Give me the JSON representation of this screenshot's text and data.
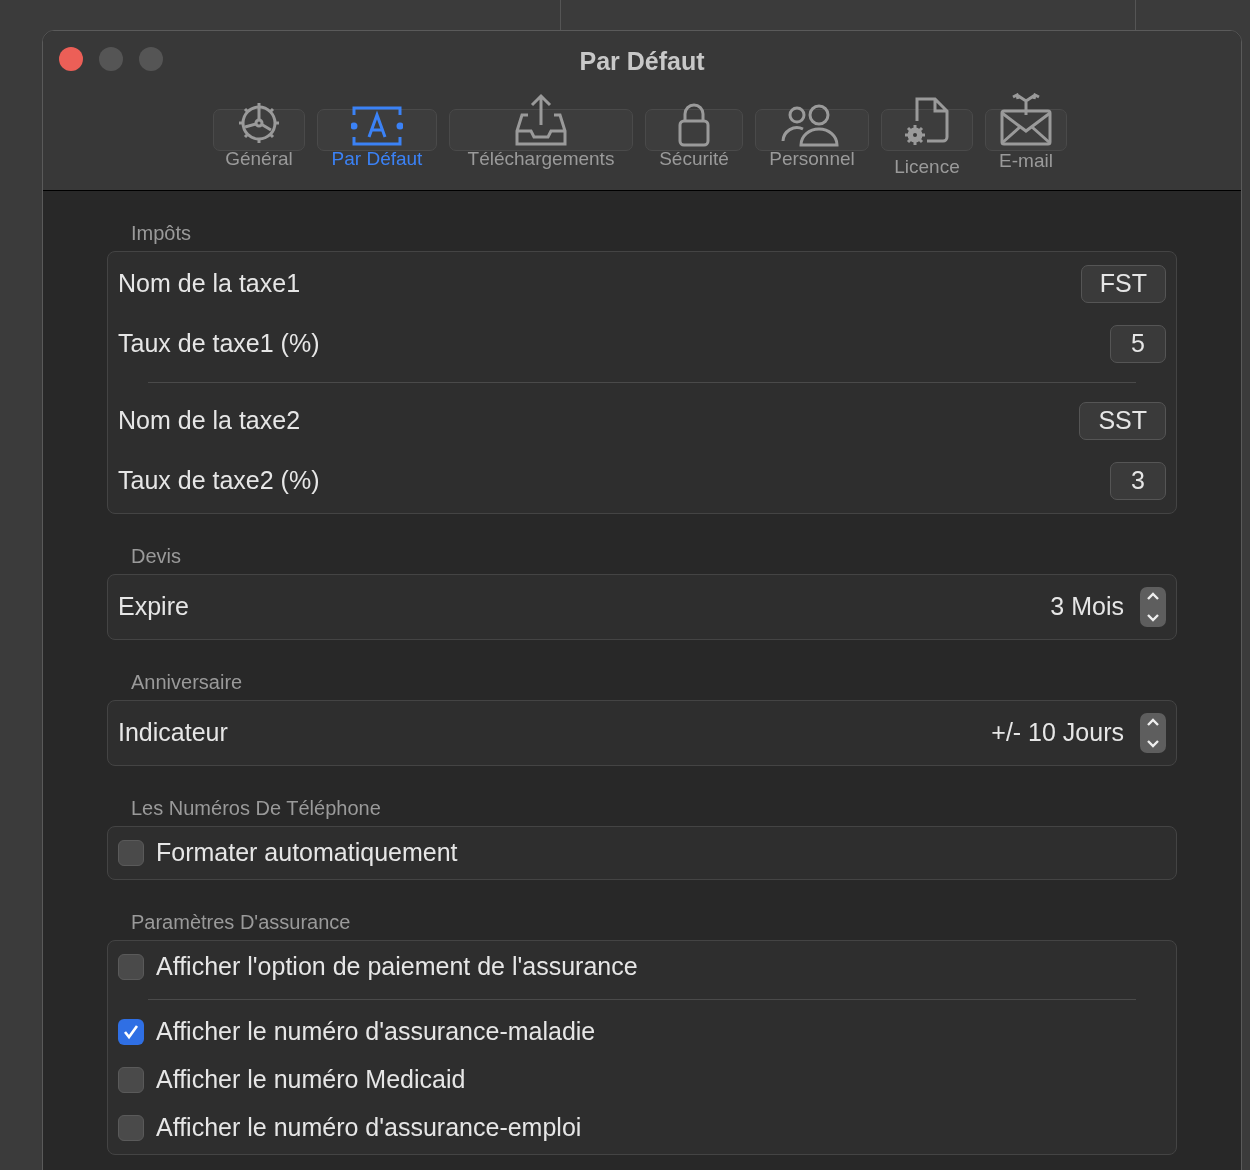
{
  "window": {
    "title": "Par Défaut"
  },
  "toolbar": {
    "tabs": [
      {
        "label": "Général",
        "selected": false
      },
      {
        "label": "Par Défaut",
        "selected": true
      },
      {
        "label": "Téléchargements",
        "selected": false
      },
      {
        "label": "Sécurité",
        "selected": false
      },
      {
        "label": "Personnel",
        "selected": false
      },
      {
        "label": "Licence",
        "selected": false
      },
      {
        "label": "E-mail",
        "selected": false
      }
    ]
  },
  "sections": [
    {
      "title": "Impôts",
      "groups": [
        [
          {
            "kind": "field",
            "label": "Nom de la taxe1",
            "value": "FST"
          },
          {
            "kind": "field",
            "label": "Taux de taxe1 (%)",
            "value": "5"
          }
        ],
        [
          {
            "kind": "field",
            "label": "Nom de la taxe2",
            "value": "SST"
          },
          {
            "kind": "field",
            "label": "Taux de taxe2 (%)",
            "value": "3"
          }
        ]
      ]
    },
    {
      "title": "Devis",
      "groups": [
        [
          {
            "kind": "stepper",
            "label": "Expire",
            "value": "3 Mois"
          }
        ]
      ]
    },
    {
      "title": "Anniversaire",
      "groups": [
        [
          {
            "kind": "stepper",
            "label": "Indicateur",
            "value": "+/- 10 Jours"
          }
        ]
      ]
    },
    {
      "title": "Les Numéros De Téléphone",
      "groups": [
        [
          {
            "kind": "checkbox",
            "label": "Formater automatiquement",
            "checked": false
          }
        ]
      ]
    },
    {
      "title": "Paramètres D'assurance",
      "groups": [
        [
          {
            "kind": "checkbox",
            "label": "Afficher l'option de paiement de l'assurance",
            "checked": false
          }
        ],
        [
          {
            "kind": "checkbox",
            "label": "Afficher le numéro d'assurance-maladie",
            "checked": true
          },
          {
            "kind": "checkbox",
            "label": "Afficher le numéro Medicaid",
            "checked": false
          },
          {
            "kind": "checkbox",
            "label": "Afficher le numéro d'assurance-emploi",
            "checked": false
          }
        ]
      ]
    }
  ]
}
